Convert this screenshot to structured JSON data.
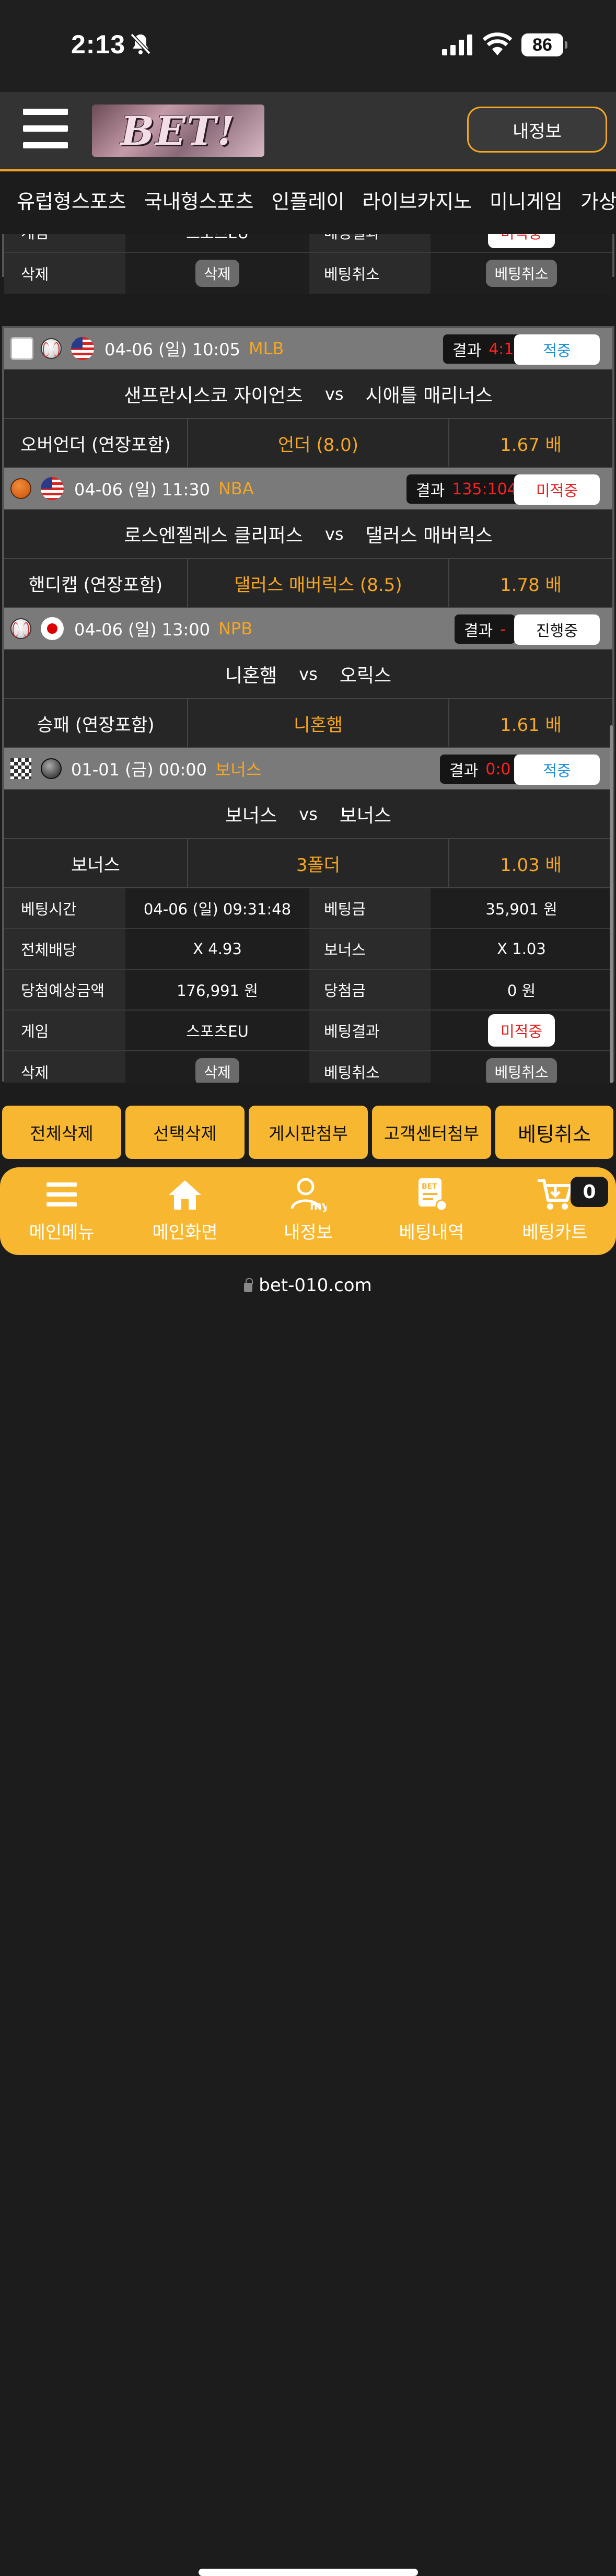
{
  "status_bar": {
    "time": "2:13",
    "battery": "86"
  },
  "header": {
    "logo_text": "BET!",
    "myinfo_button": "내정보"
  },
  "tabs": [
    "유럽형스포츠",
    "국내형스포츠",
    "인플레이",
    "라이브카지노",
    "미니게임",
    "가상게임"
  ],
  "top_box": {
    "rows": [
      {
        "label1": "게임",
        "value1": "스포츠EU",
        "label2": "베팅결과",
        "value2": "미적중"
      },
      {
        "label1": "삭제",
        "value1": "삭제",
        "label2": "베팅취소",
        "value2": "베팅취소"
      }
    ]
  },
  "games": [
    {
      "date": "04-06 (일) 10:05",
      "league": "MLB",
      "result_label": "결과",
      "score": "4:1",
      "state": "적중",
      "state_color": "#1a8fd8",
      "home": "샌프란시스코 자이언츠",
      "vs": "vs",
      "away": "시애틀 매리너스",
      "market": "오버언더 (연장포함)",
      "pick": "언더 (8.0)",
      "odds": "1.67 배"
    },
    {
      "date": "04-06 (일) 11:30",
      "league": "NBA",
      "result_label": "결과",
      "score": "135:104",
      "state": "미적중",
      "state_color": "#e02020",
      "home": "로스엔젤레스 클리퍼스",
      "vs": "vs",
      "away": "댈러스 매버릭스",
      "market": "핸디캡 (연장포함)",
      "pick": "댈러스 매버릭스 (8.5)",
      "odds": "1.78 배"
    },
    {
      "date": "04-06 (일) 13:00",
      "league": "NPB",
      "result_label": "결과",
      "score": "-",
      "state": "진행중",
      "state_color": "#111111",
      "home": "니혼햄",
      "vs": "vs",
      "away": "오릭스",
      "market": "승패 (연장포함)",
      "pick": "니혼햄",
      "odds": "1.61 배"
    },
    {
      "date": "01-01 (금) 00:00",
      "league": "보너스",
      "result_label": "결과",
      "score": "0:0",
      "state": "적중",
      "state_color": "#1a8fd8",
      "home": "보너스",
      "vs": "vs",
      "away": "보너스",
      "market": "보너스",
      "pick": "3폴더",
      "odds": "1.03 배"
    }
  ],
  "summary": [
    {
      "label1": "베팅시간",
      "value1": "04-06 (일) 09:31:48",
      "label2": "베팅금",
      "value2": "35,901 원"
    },
    {
      "label1": "전체배당",
      "value1": "X 4.93",
      "label2": "보너스",
      "value2": "X 1.03"
    },
    {
      "label1": "당첨예상금액",
      "value1": "176,991 원",
      "label2": "당첨금",
      "value2": "0 원"
    },
    {
      "label1": "게임",
      "value1": "스포츠EU",
      "label2": "베팅결과",
      "value2": "미적중"
    },
    {
      "label1": "삭제",
      "value1": "삭제",
      "label2": "베팅취소",
      "value2": "베팅취소"
    }
  ],
  "actions": [
    "전체삭제",
    "선택삭제",
    "게시판첨부",
    "고객센터첨부",
    "베팅취소"
  ],
  "bottom_nav": [
    {
      "label": "메인메뉴",
      "icon": "menu-icon"
    },
    {
      "label": "메인화면",
      "icon": "home-icon"
    },
    {
      "label": "내정보",
      "icon": "user-icon"
    },
    {
      "label": "베팅내역",
      "icon": "bet-history-icon"
    },
    {
      "label": "베팅카트",
      "icon": "cart-icon"
    }
  ],
  "cart_count": "0",
  "url": "bet-010.com",
  "colors": {
    "accent": "#f7b731",
    "lose": "#e02020",
    "win": "#1a8fd8"
  }
}
